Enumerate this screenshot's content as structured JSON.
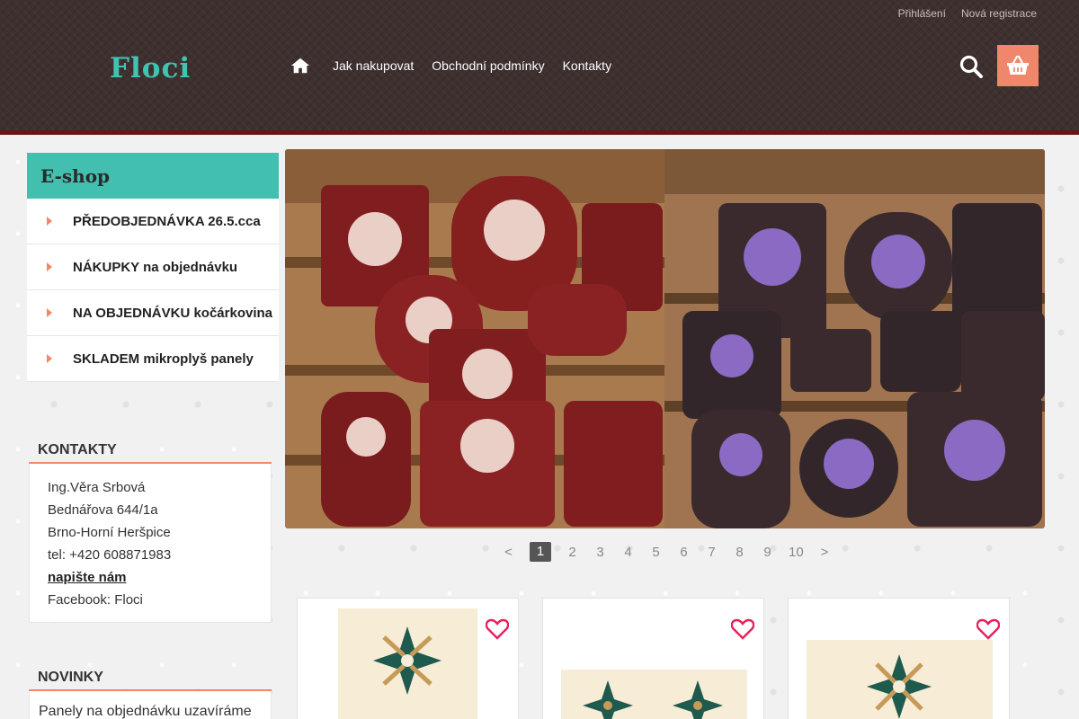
{
  "header": {
    "logo": "Floci",
    "top_links": [
      "Přihlášení",
      "Nová registrace"
    ],
    "nav": [
      "Jak nakupovat",
      "Obchodní podmínky",
      "Kontakty"
    ],
    "icons": [
      "home-icon",
      "search-icon",
      "basket-icon"
    ]
  },
  "sidebar": {
    "eshop_title": "E-shop",
    "categories": [
      "PŘEDOBJEDNÁVKA 26.5.cca",
      "NÁKUPKY na objednávku",
      "NA OBJEDNÁVKU kočárkovina",
      "SKLADEM mikroplyš panely"
    ],
    "contacts": {
      "title": "KONTAKTY",
      "name": "Ing.Věra Srbová",
      "street": "Bednářova 644/1a",
      "city": "Brno-Horní Heršpice",
      "phone": "tel: +420 608871983",
      "write_link": "napište nám",
      "facebook": "Facebook: Floci"
    },
    "news": {
      "title": "NOVINKY",
      "text": "Panely na objednávku uzavíráme"
    }
  },
  "slider": {
    "pages": [
      "<",
      "1",
      "2",
      "3",
      "4",
      "5",
      "6",
      "7",
      "8",
      "9",
      "10",
      ">"
    ],
    "active_page": "1"
  },
  "colors": {
    "accent": "#f0876a",
    "teal": "#43bfb0",
    "header_bg": "#3d302e",
    "header_border": "#6b1416"
  }
}
